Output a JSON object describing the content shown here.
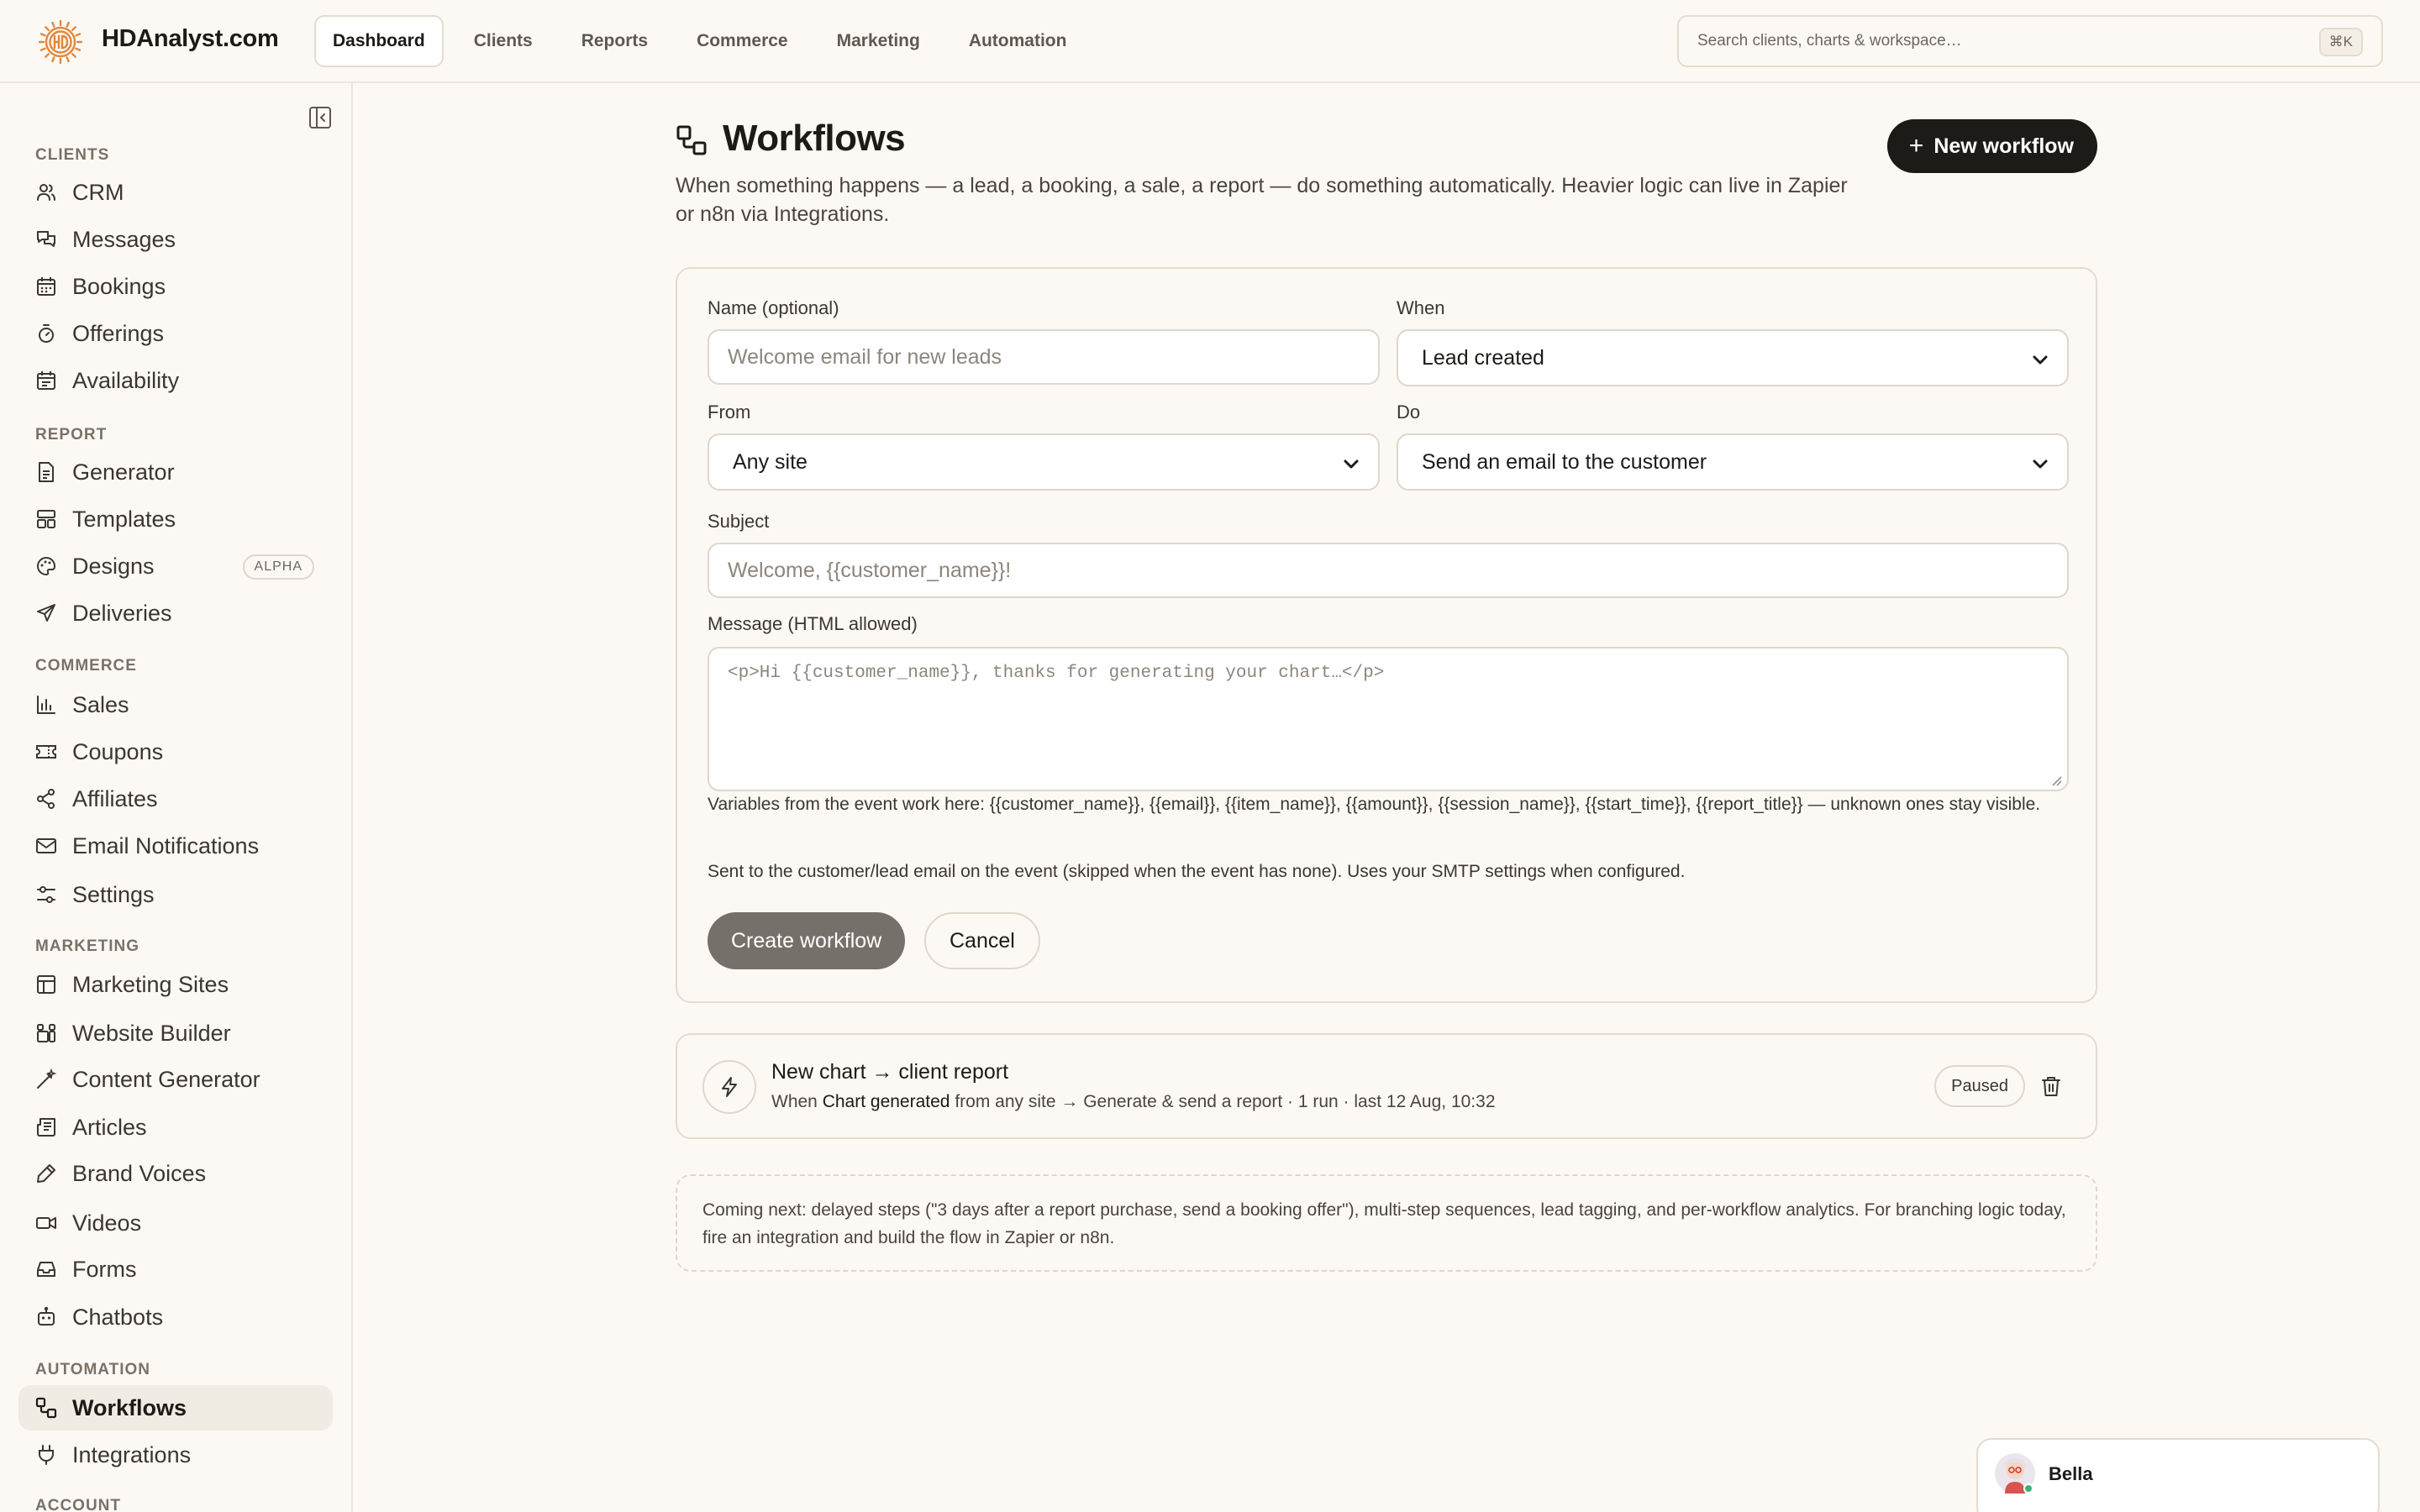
{
  "brand": {
    "name": "HDAnalyst.com"
  },
  "topnav": [
    {
      "label": "Dashboard",
      "active": true
    },
    {
      "label": "Clients"
    },
    {
      "label": "Reports"
    },
    {
      "label": "Commerce"
    },
    {
      "label": "Marketing"
    },
    {
      "label": "Automation"
    }
  ],
  "search": {
    "placeholder": "Search clients, charts & workspace…",
    "shortcut": "⌘K"
  },
  "sidebar": {
    "sections": [
      {
        "label": "CLIENTS",
        "items": [
          "CRM",
          "Messages",
          "Bookings",
          "Offerings",
          "Availability"
        ]
      },
      {
        "label": "REPORT",
        "items": [
          "Generator",
          "Templates",
          "Designs",
          "Deliveries"
        ],
        "badge": "ALPHA"
      },
      {
        "label": "COMMERCE",
        "items": [
          "Sales",
          "Coupons",
          "Affiliates",
          "Email Notifications",
          "Settings"
        ]
      },
      {
        "label": "MARKETING",
        "items": [
          "Marketing Sites",
          "Website Builder",
          "Content Generator",
          "Articles",
          "Brand Voices",
          "Videos",
          "Forms",
          "Chatbots"
        ]
      },
      {
        "label": "AUTOMATION",
        "items": [
          "Workflows",
          "Integrations"
        ]
      },
      {
        "label": "ACCOUNT"
      }
    ],
    "active": "Workflows"
  },
  "page": {
    "title": "Workflows",
    "description": "When something happens — a lead, a booking, a sale, a report — do something automatically. Heavier logic can live in Zapier or n8n via Integrations.",
    "new_button": "New workflow"
  },
  "form": {
    "name_label": "Name (optional)",
    "name_placeholder": "Welcome email for new leads",
    "when_label": "When",
    "when_value": "Lead created",
    "from_label": "From",
    "from_value": "Any site",
    "do_label": "Do",
    "do_value": "Send an email to the customer",
    "subject_label": "Subject",
    "subject_placeholder": "Welcome, {{customer_name}}!",
    "message_label": "Message (HTML allowed)",
    "message_placeholder": "<p>Hi {{customer_name}}, thanks for generating your chart…</p>",
    "variables_hint": "Variables from the event work here: {{customer_name}}, {{email}}, {{item_name}}, {{amount}}, {{session_name}}, {{start_time}}, {{report_title}} — unknown ones stay visible.",
    "send_hint": "Sent to the customer/lead email on the event (skipped when the event has none). Uses your SMTP settings when configured.",
    "create_button": "Create workflow",
    "cancel_button": "Cancel"
  },
  "workflows": [
    {
      "name": "New chart → client report",
      "meta_prefix": "When",
      "trigger": "Chart generated",
      "meta_suffix": "from any site → Generate & send a report · 1 run · last 12 Aug, 10:32",
      "status": "Paused"
    }
  ],
  "note": "Coming next: delayed steps (\"3 days after a report purchase, send a booking offer\"), multi-step sequences, lead tagging, and per-workflow analytics. For branching logic today, fire an integration and build the flow in Zapier or n8n.",
  "chat": {
    "name": "Bella"
  },
  "colors": {
    "accent": "#1d1a17",
    "brand": "#e2873a",
    "online": "#3bb273"
  }
}
